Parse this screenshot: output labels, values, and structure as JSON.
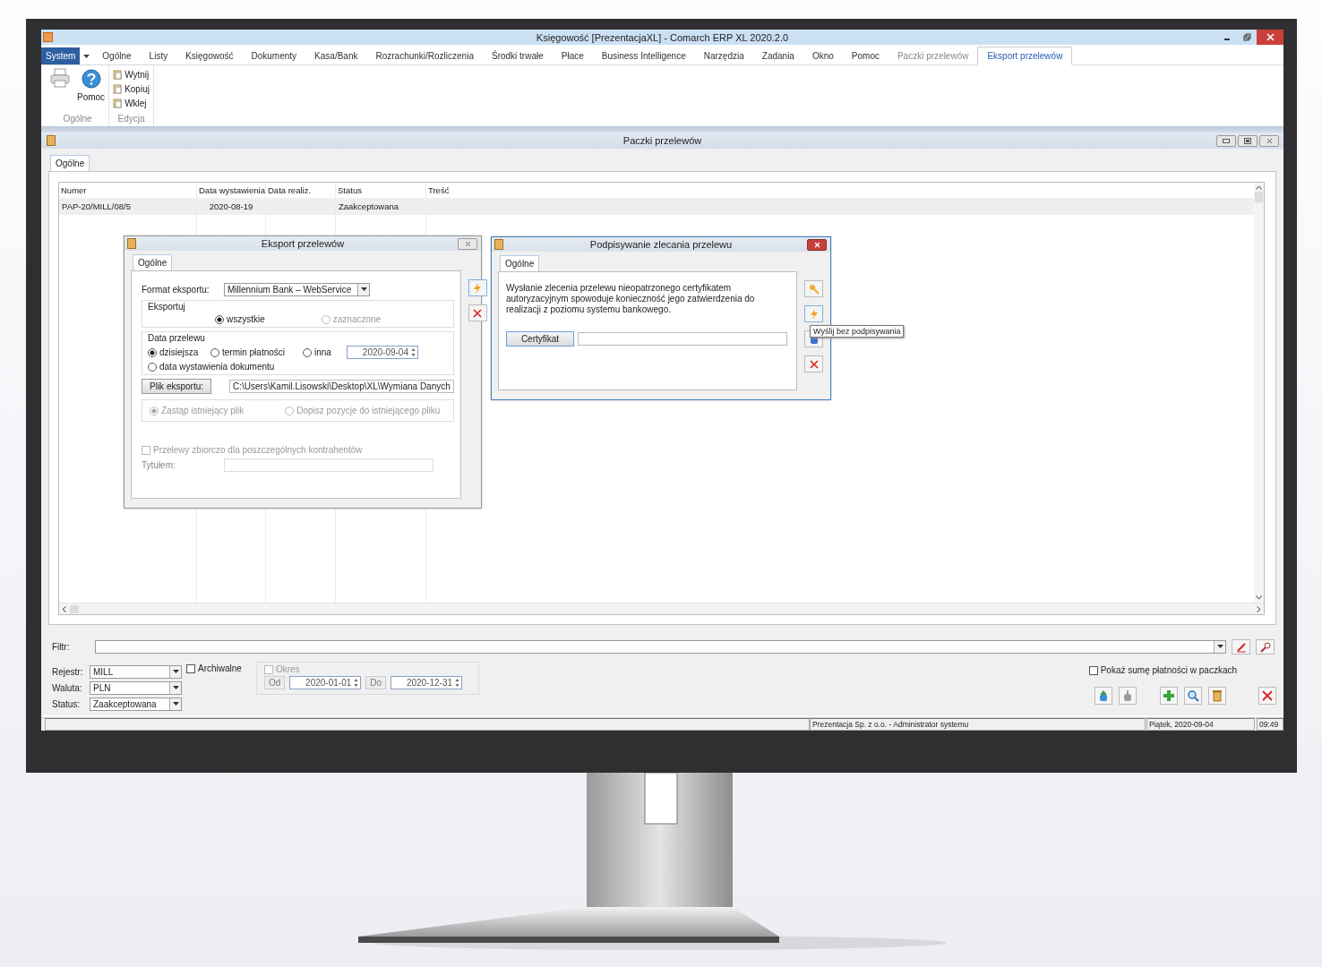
{
  "app_window": {
    "title": "Księgowość [PrezentacjaXL] - Comarch ERP XL 2020.2.0",
    "menu_tabs": [
      {
        "label": "System",
        "kind": "app",
        "selected": false
      },
      {
        "label": "Ogólne",
        "kind": "normal",
        "selected": false
      },
      {
        "label": "Listy",
        "kind": "normal",
        "selected": false
      },
      {
        "label": "Księgowość",
        "kind": "normal",
        "selected": false
      },
      {
        "label": "Dokumenty",
        "kind": "normal",
        "selected": false
      },
      {
        "label": "Kasa/Bank",
        "kind": "normal",
        "selected": false
      },
      {
        "label": "Rozrachunki/Rozliczenia",
        "kind": "normal",
        "selected": false
      },
      {
        "label": "Środki trwałe",
        "kind": "normal",
        "selected": false
      },
      {
        "label": "Płace",
        "kind": "normal",
        "selected": false
      },
      {
        "label": "Business Intelligence",
        "kind": "normal",
        "selected": false
      },
      {
        "label": "Narzędzia",
        "kind": "normal",
        "selected": false
      },
      {
        "label": "Zadania",
        "kind": "normal",
        "selected": false
      },
      {
        "label": "Okno",
        "kind": "normal",
        "selected": false
      },
      {
        "label": "Pomoc",
        "kind": "normal",
        "selected": false
      },
      {
        "label": "Paczki przelewów",
        "kind": "context",
        "selected": false
      },
      {
        "label": "Eksport przelewów",
        "kind": "context",
        "selected": true
      }
    ]
  },
  "ribbon": {
    "groups": [
      {
        "label": "Ogólne",
        "kind": "large",
        "buttons": [
          {
            "label": "Pomoc"
          }
        ]
      },
      {
        "label": "Edycja",
        "kind": "small",
        "buttons": [
          {
            "label": "Wytnij"
          },
          {
            "label": "Kopiuj"
          },
          {
            "label": "Wklej"
          }
        ]
      }
    ]
  },
  "list_window": {
    "title": "Paczki przelewów",
    "tabs": [
      {
        "label": "Ogólne",
        "selected": true
      }
    ],
    "table": {
      "columns": [
        "Numer",
        "Data wystawienia",
        "Data realiz.",
        "Status",
        "Treść"
      ],
      "rows": [
        [
          "PAP-20/MILL/08/5",
          "2020-08-19",
          null,
          "Zaakceptowana",
          null
        ]
      ]
    },
    "filter": {
      "label": "Filtr:"
    },
    "combos": [
      {
        "label": "Rejestr:",
        "value": "MILL"
      },
      {
        "label": "Waluta:",
        "value": "PLN"
      },
      {
        "label": "Status:",
        "value": "Zaakceptowana"
      }
    ],
    "archive": {
      "label": "Archiwalne",
      "checked": false
    },
    "period": {
      "label": "Okres",
      "checked": false,
      "from_label": "Od",
      "from": "2020-01-01",
      "to_label": "Do",
      "to": "2020-12-31"
    },
    "sum_checkbox": {
      "label": "Pokaż sumę płatności w paczkach",
      "checked": false
    }
  },
  "export_dialog": {
    "title": "Eksport przelewów",
    "tabs": [
      {
        "label": "Ogólne",
        "selected": true
      }
    ],
    "format": {
      "label": "Format eksportu:",
      "value": "Millennium Bank – WebService"
    },
    "scope": {
      "label": "Eksportuj",
      "options": [
        {
          "label": "wszystkie",
          "selected": true,
          "disabled": false
        },
        {
          "label": "zaznaczone",
          "selected": false,
          "disabled": true
        }
      ]
    },
    "transfer_date": {
      "label": "Data przelewu",
      "options": [
        {
          "label": "dzisiejsza",
          "selected": true
        },
        {
          "label": "termin płatności",
          "selected": false
        },
        {
          "label": "inna",
          "selected": false
        },
        {
          "label": "data wystawienia dokumentu",
          "selected": false
        }
      ],
      "date": "2020-09-04"
    },
    "file": {
      "button": "Plik eksportu:",
      "value": "C:\\Users\\Kamil.Lisowski\\Desktop\\XL\\Wymiana Danych"
    },
    "file_mode": {
      "options": [
        {
          "label": "Zastąp istniejący plik",
          "selected": true
        },
        {
          "label": "Dopisz pozycje do istniejącego pliku",
          "selected": false
        }
      ]
    },
    "bulk": {
      "label": "Przelewy zbiorczo dla poszczególnych kontrahentów",
      "checked": false
    },
    "title_field": {
      "label": "Tytułem:"
    }
  },
  "sign_dialog": {
    "title": "Podpisywanie zlecania przelewu",
    "tabs": [
      {
        "label": "Ogólne",
        "selected": true
      }
    ],
    "message": "Wysłanie zlecenia przelewu nieopatrzonego certyfikatem autoryzacyjnym spowoduje konieczność jego zatwierdzenia do realizacji z poziomu systemu bankowego.",
    "certificate_button": "Certyfikat",
    "tooltip": "Wyślij bez podpisywania"
  },
  "status_bar": [
    "Prezentacja Sp. z o.o. - Administrator systemu",
    "Piątek, 2020-09-04",
    "09:49"
  ]
}
